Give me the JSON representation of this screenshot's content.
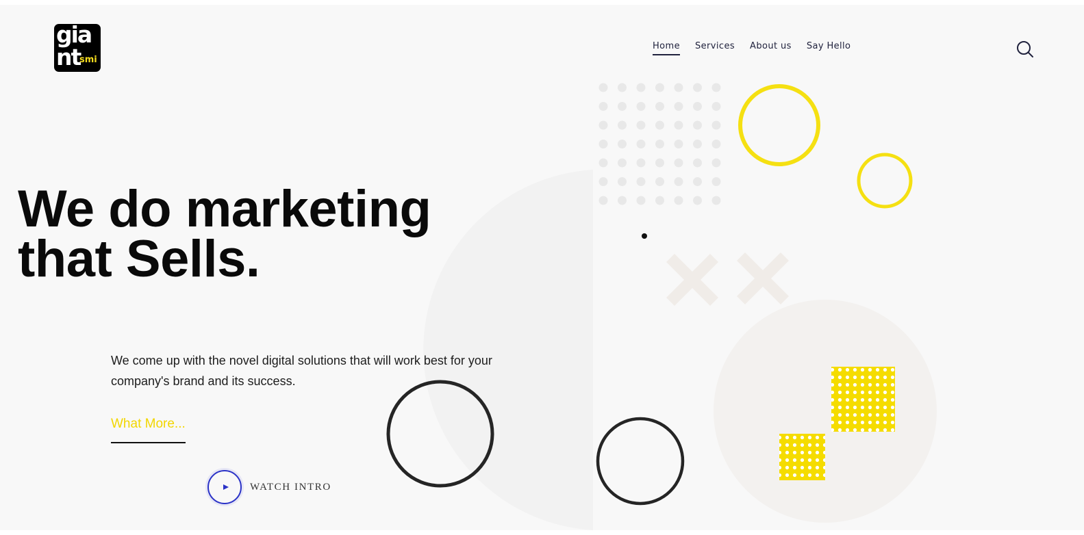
{
  "brand": {
    "logo_line1": "gia",
    "logo_line2": "nt",
    "logo_suffix": "smi",
    "logo_color": "#000000",
    "logo_accent": "#f5dc1e"
  },
  "nav": {
    "items": [
      {
        "label": "Home",
        "active": true
      },
      {
        "label": "Services",
        "active": false
      },
      {
        "label": "About us",
        "active": false
      },
      {
        "label": "Say Hello",
        "active": false
      }
    ],
    "search_icon": "search-icon"
  },
  "hero": {
    "title_line1": "We do marketing",
    "title_line2": "that Sells.",
    "description": "We come up with the novel digital solutions that will work best for your company's brand and its success.",
    "cta_label": "What More...",
    "watch_label": "WATCH INTRO"
  },
  "colors": {
    "accent_yellow": "#f5e012",
    "link_yellow": "#f2d600",
    "play_blue": "#2b33c7",
    "text_dark": "#0a0a0a"
  }
}
